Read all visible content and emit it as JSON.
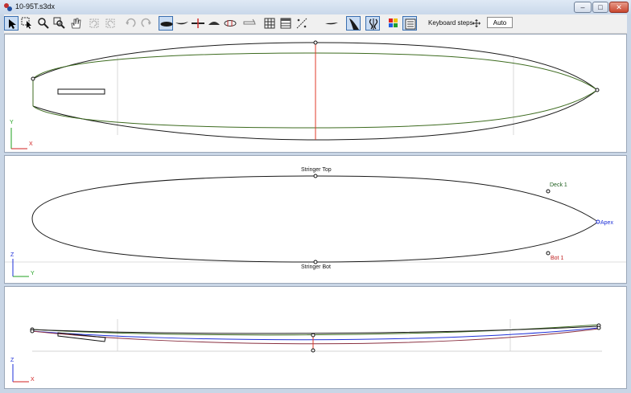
{
  "window": {
    "title": "10-95T.s3dx",
    "minimize": "–",
    "maximize": "□",
    "close": "✕"
  },
  "toolbar": {
    "keyboard_steps_label": "Keyboard steps",
    "auto_label": "Auto"
  },
  "cross_section": {
    "stringer_top": "Stringer Top",
    "stringer_bot": "Stringer Bot",
    "deck": "Deck 1",
    "bot": "Bot 1",
    "apex": "Apex"
  },
  "axes": {
    "outline": {
      "v": "Y",
      "h": "X"
    },
    "cross_section": {
      "v": "Z",
      "h": "Y"
    },
    "profile": {
      "v": "Z",
      "h": "X"
    }
  },
  "colors": {
    "outline_curve": "#1a1a1a",
    "guide_curve": "#3d6b1f",
    "centerline": "#e03a2a",
    "rocker_bottom": "#1d2fd8",
    "deck_label": "#206020",
    "bot_label": "#c02020",
    "apex_label": "#1d2fd8",
    "axis_y": "#1fa01f",
    "axis_x": "#d02020"
  }
}
